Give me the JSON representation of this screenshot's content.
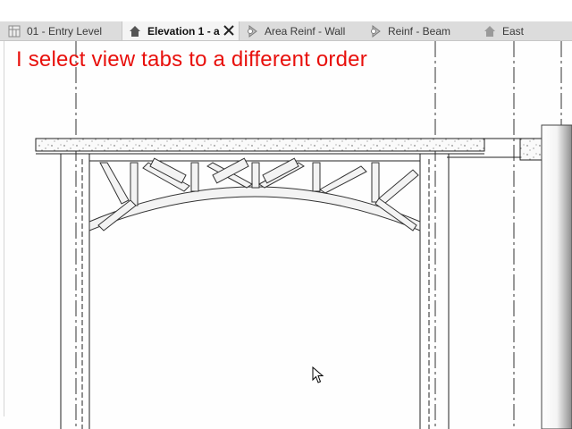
{
  "tabs": [
    {
      "label": "01 - Entry Level",
      "icon": "floor-plan-icon",
      "active": false
    },
    {
      "label": "Elevation 1 - a",
      "icon": "elevation-house-icon",
      "active": true
    },
    {
      "label": "Area Reinf - Wall",
      "icon": "section-view-icon",
      "active": false
    },
    {
      "label": "Reinf - Beam",
      "icon": "section-view-icon",
      "active": false
    },
    {
      "label": "East",
      "icon": "elevation-house-icon",
      "active": false
    }
  ],
  "caption": "I select view tabs to a different order",
  "colors": {
    "caption": "#e8100c",
    "tabbar": "#dcdcdc",
    "active_tab": "#f4f4f4"
  }
}
